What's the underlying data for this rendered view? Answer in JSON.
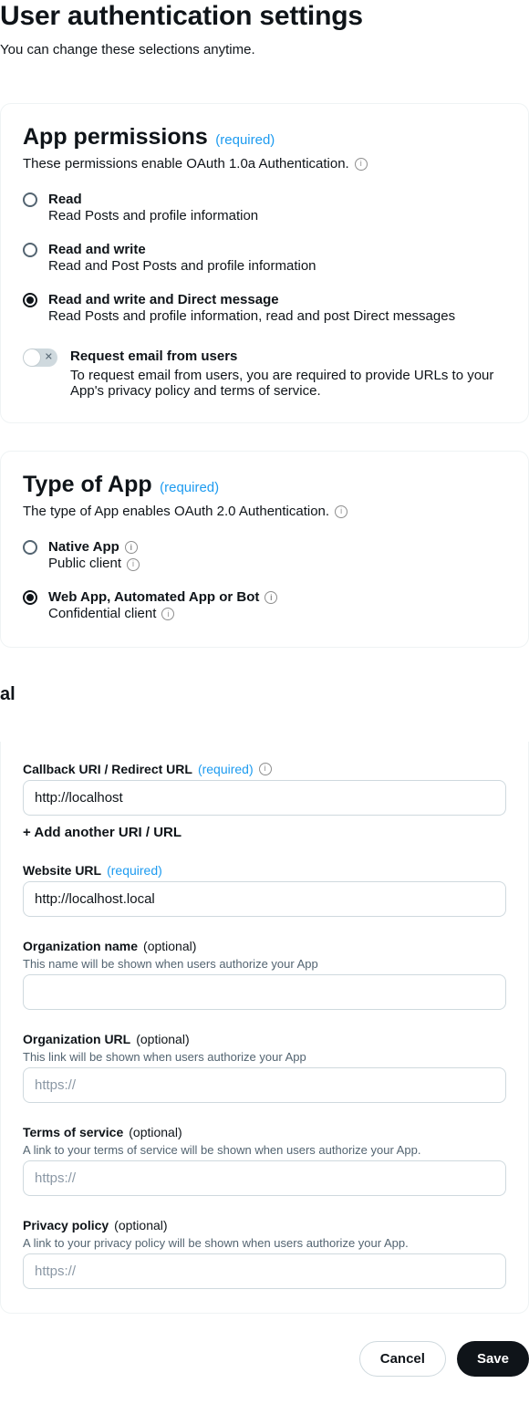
{
  "header": {
    "title": "User authentication settings",
    "subtitle": "You can change these selections anytime."
  },
  "required_label": "(required)",
  "optional_label": "(optional)",
  "app_permissions": {
    "title": "App permissions",
    "desc": "These permissions enable OAuth 1.0a Authentication.",
    "options": [
      {
        "label": "Read",
        "sub": "Read Posts and profile information",
        "selected": false
      },
      {
        "label": "Read and write",
        "sub": "Read and Post Posts and profile information",
        "selected": false
      },
      {
        "label": "Read and write and Direct message",
        "sub": "Read Posts and profile information, read and post Direct messages",
        "selected": true
      }
    ],
    "email_toggle": {
      "title": "Request email from users",
      "desc": "To request email from users, you are required to provide URLs to your App's privacy policy and terms of service."
    }
  },
  "type_of_app": {
    "title": "Type of App",
    "desc": "The type of App enables OAuth 2.0 Authentication.",
    "options": [
      {
        "label": "Native App",
        "sub": "Public client",
        "selected": false
      },
      {
        "label": "Web App, Automated App or Bot",
        "sub": "Confidential client",
        "selected": true
      }
    ]
  },
  "app_info": {
    "cutoff_heading": "al",
    "callback": {
      "label": "Callback URI / Redirect URL",
      "value": "http://localhost",
      "add_label": "+ Add another URI / URL"
    },
    "website": {
      "label": "Website URL",
      "value": "http://localhost.local"
    },
    "org_name": {
      "label": "Organization name",
      "help": "This name will be shown when users authorize your App",
      "value": ""
    },
    "org_url": {
      "label": "Organization URL",
      "help": "This link will be shown when users authorize your App",
      "placeholder": "https://"
    },
    "tos": {
      "label": "Terms of service",
      "help": "A link to your terms of service will be shown when users authorize your App.",
      "placeholder": "https://"
    },
    "privacy": {
      "label": "Privacy policy",
      "help": "A link to your privacy policy will be shown when users authorize your App.",
      "placeholder": "https://"
    }
  },
  "footer": {
    "cancel": "Cancel",
    "save": "Save"
  }
}
